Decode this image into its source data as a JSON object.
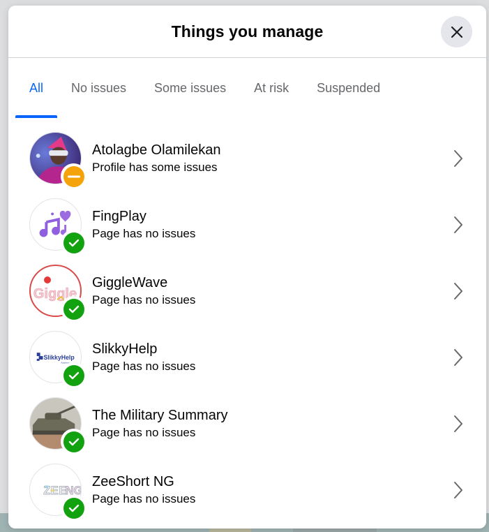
{
  "modal": {
    "title": "Things you manage",
    "close_icon": "close-icon"
  },
  "tabs": [
    {
      "label": "All",
      "active": true
    },
    {
      "label": "No issues",
      "active": false
    },
    {
      "label": "Some issues",
      "active": false
    },
    {
      "label": "At risk",
      "active": false
    },
    {
      "label": "Suspended",
      "active": false
    }
  ],
  "items": [
    {
      "name": "Atolagbe Olamilekan",
      "status": "Profile has some issues",
      "badge": "minus-icon",
      "badge_color": "#f5a30a",
      "avatar": "profile-photo"
    },
    {
      "name": "FingPlay",
      "status": "Page has no issues",
      "badge": "check-icon",
      "badge_color": "#12a10f",
      "avatar": "music-notes-logo"
    },
    {
      "name": "GiggleWave",
      "status": "Page has no issues",
      "badge": "check-icon",
      "badge_color": "#12a10f",
      "avatar": "giggle-logo"
    },
    {
      "name": "SlikkyHelp",
      "status": "Page has no issues",
      "badge": "check-icon",
      "badge_color": "#12a10f",
      "avatar": "slikkyhelp-logo"
    },
    {
      "name": "The Military Summary",
      "status": "Page has no issues",
      "badge": "check-icon",
      "badge_color": "#12a10f",
      "avatar": "tank-photo"
    },
    {
      "name": "ZeeShort NG",
      "status": "Page has no issues",
      "badge": "check-icon",
      "badge_color": "#12a10f",
      "avatar": "zeeng-logo"
    }
  ],
  "colors": {
    "accent": "#0866ff",
    "warning": "#f5a30a",
    "success": "#12a10f"
  }
}
